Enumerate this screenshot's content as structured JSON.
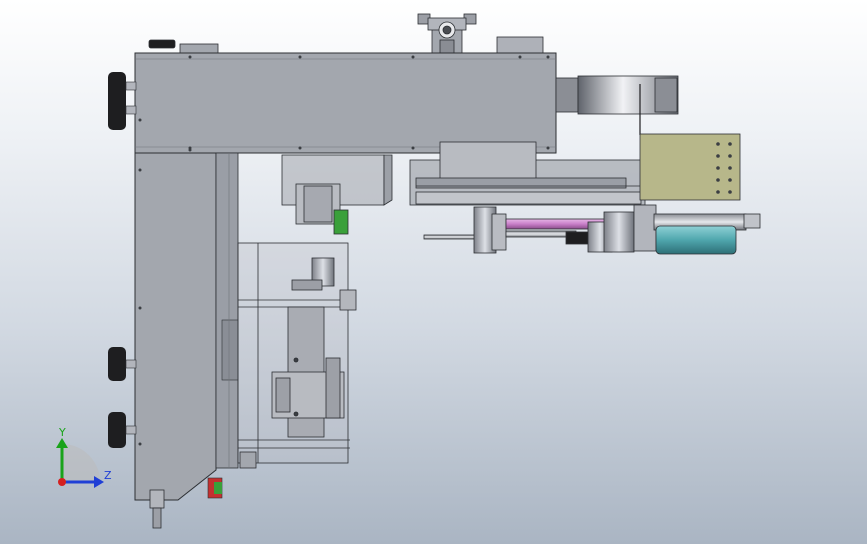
{
  "triad": {
    "y_label": "Y",
    "z_label": "Z",
    "y_color": "#1aa31a",
    "z_color": "#1f3fd6",
    "x_color": "#d42020"
  },
  "colors": {
    "frame": "#a3a7ae",
    "frame_dark": "#7c8087",
    "outline": "#2c2f33",
    "olive_plate": "#b7b78a",
    "purple_rod": "#c97fc9",
    "teal_motor": "#4fa6ad",
    "knob": "#1e1e20",
    "green_marker": "#3aa03a",
    "red_marker": "#c43030"
  }
}
